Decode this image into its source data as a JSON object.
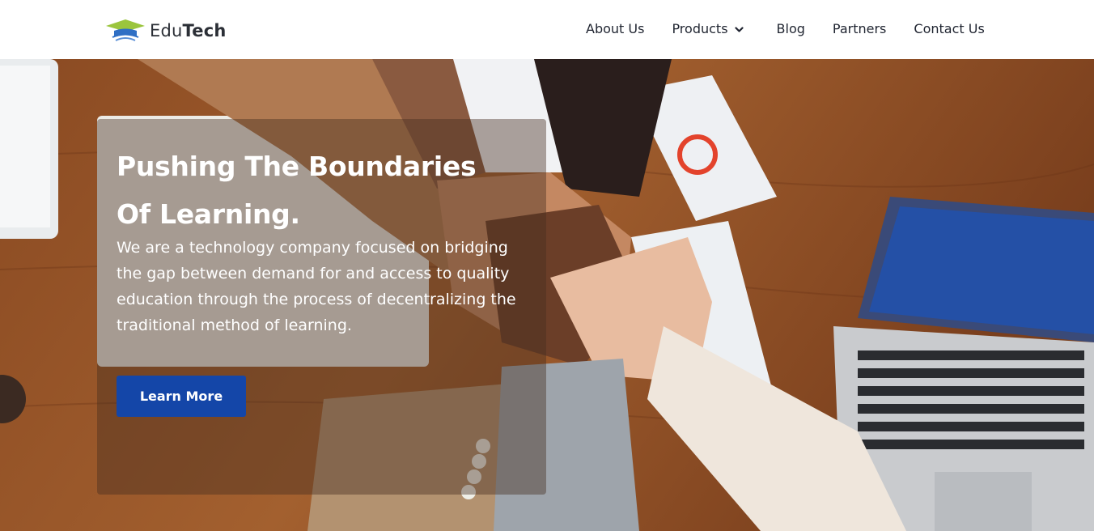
{
  "brand": {
    "name_light": "Edu",
    "name_bold": "Tech"
  },
  "nav": {
    "items": [
      {
        "label": "About Us"
      },
      {
        "label": "Products",
        "has_dropdown": true
      },
      {
        "label": "Blog"
      },
      {
        "label": "Partners"
      },
      {
        "label": "Contact Us"
      }
    ]
  },
  "hero": {
    "headline_line1": "Pushing The Boundaries",
    "headline_line2": "Of Learning.",
    "subtext": "We are a technology company focused on bridging the gap between demand for and access to quality education through the process of decentralizing the traditional method of learning.",
    "cta_label": "Learn More"
  },
  "colors": {
    "accent": "#1446a8",
    "logo_green": "#9bc53d",
    "logo_blue": "#2f6fc4",
    "text_dark": "#1f2430"
  },
  "icons": {
    "logo": "graduation-cap-logo-icon",
    "products_dropdown": "chevron-down-icon"
  }
}
